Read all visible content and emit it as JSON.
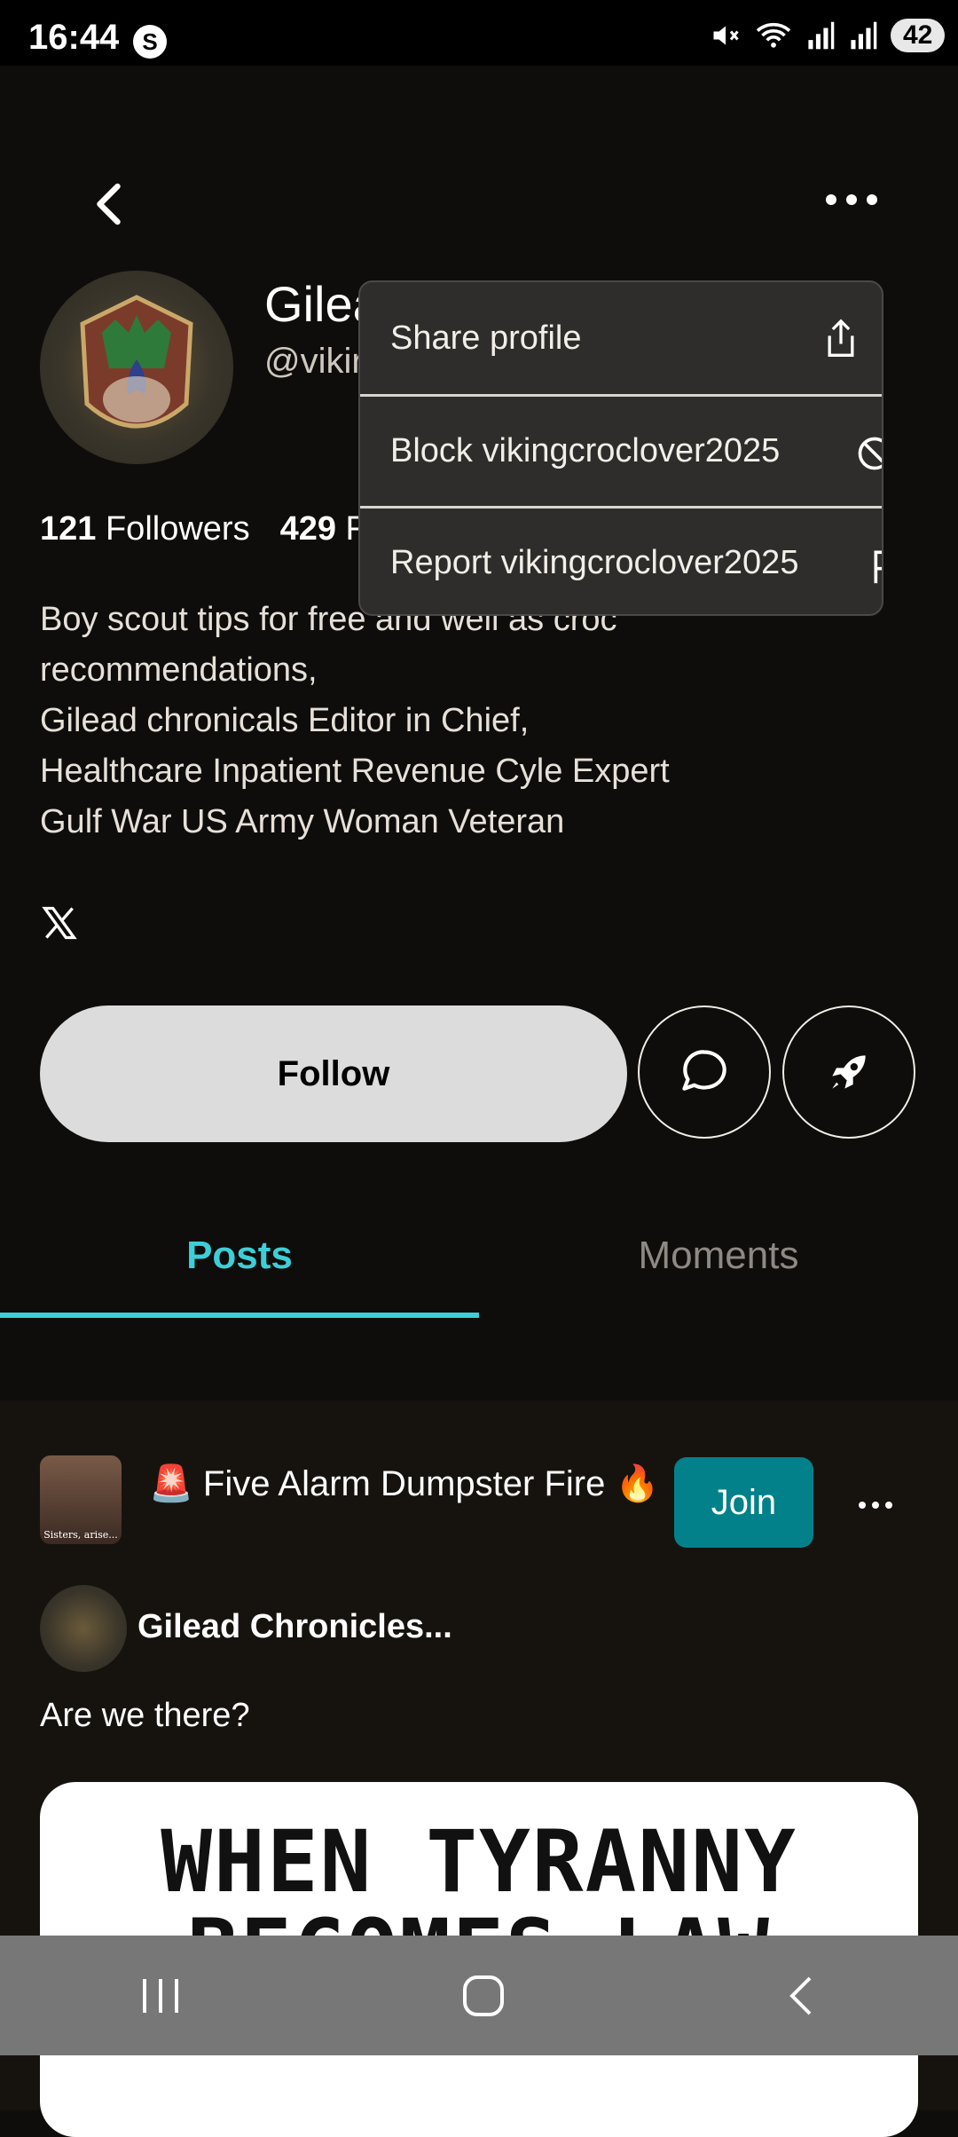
{
  "status_bar": {
    "time": "16:44",
    "badge": "S",
    "battery": "42"
  },
  "profile": {
    "name": "Gilea",
    "handle": "@vikir",
    "followers_count": "121",
    "followers_label": "Followers",
    "following_count": "429",
    "following_label": "F",
    "bio_lines": [
      "Boy scout tips for free and well as croc",
      "recommendations,",
      "Gilead chronicals Editor in Chief,",
      "Healthcare Inpatient Revenue Cyle Expert",
      "Gulf War US Army Woman Veteran"
    ]
  },
  "actions": {
    "follow_label": "Follow"
  },
  "tabs": [
    {
      "label": "Posts",
      "active": true
    },
    {
      "label": "Moments",
      "active": false
    }
  ],
  "menu": {
    "items": [
      {
        "label": "Share profile",
        "icon": "share-icon"
      },
      {
        "label": "Block vikingcroclover2025",
        "icon": "block-icon"
      },
      {
        "label": "Report vikingcroclover2025",
        "icon": "report-icon"
      }
    ]
  },
  "feed": {
    "group_title": "🚨 Five Alarm Dumpster Fire 🔥",
    "group_thumb_caption": "Sisters, arise...",
    "join_label": "Join",
    "post_author": "Gilead  Chronicles...",
    "post_text": "Are we there?",
    "post_image_text": "WHEN TYRANNY BECOMES LAW"
  },
  "colors": {
    "accent": "#3ccfd8",
    "join": "#03818a",
    "background": "#0f0d0b"
  }
}
